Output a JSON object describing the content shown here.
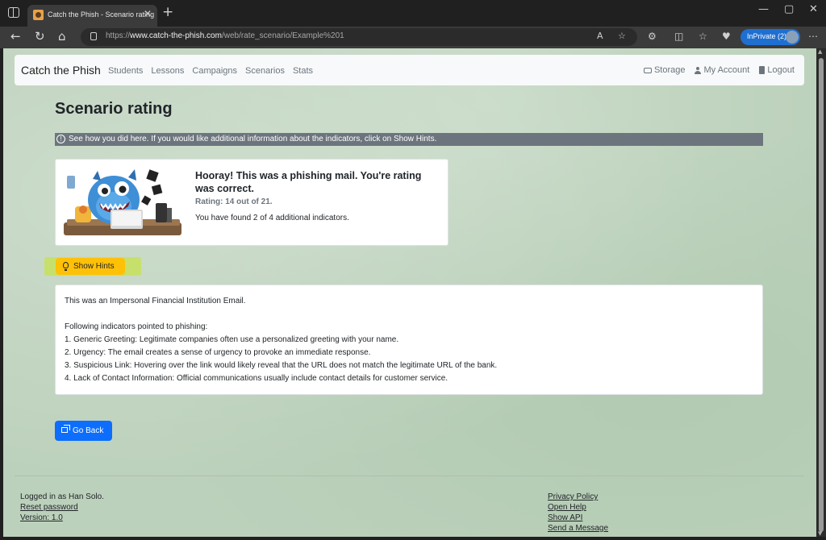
{
  "browser": {
    "tab_title": "Catch the Phish - Scenario rating",
    "url_prefix": "https://",
    "url_domain": "www.catch-the-phish.com",
    "url_path": "/web/rate_scenario/Example%201",
    "inprivate_label": "InPrivate (2)"
  },
  "navbar": {
    "brand": "Catch the Phish",
    "links": [
      "Students",
      "Lessons",
      "Campaigns",
      "Scenarios",
      "Stats"
    ],
    "storage": "Storage",
    "account": "My Account",
    "logout": "Logout"
  },
  "page": {
    "title": "Scenario rating",
    "info": "See how you did here. If you would like additional information about the indicators, click on Show Hints."
  },
  "result": {
    "headline": "Hooray! This was a phishing mail. You're rating was correct.",
    "rating": "Rating: 14 out of 21.",
    "found": "You have found 2 of 4 additional indicators."
  },
  "hints": {
    "button_label": "Show Hints",
    "intro": "This was an Impersonal Financial Institution Email.",
    "lead": "Following indicators pointed to phishing:",
    "items": [
      "1. Generic Greeting: Legitimate companies often use a personalized greeting with your name.",
      "2. Urgency: The email creates a sense of urgency to provoke an immediate response.",
      "3. Suspicious Link: Hovering over the link would likely reveal that the URL does not match the legitimate URL of the bank.",
      "4. Lack of Contact Information: Official communications usually include contact details for customer service."
    ]
  },
  "back_button": "Go Back",
  "footer": {
    "logged_in": "Logged in as Han Solo.",
    "reset": "Reset password",
    "version": "Version: 1.0",
    "links": [
      "Privacy Policy",
      "Open Help",
      "Show API",
      "Send a Message"
    ]
  },
  "colors": {
    "info_bar": "#6c757d",
    "hints_button": "#ffc107",
    "hints_highlight": "#c7e06b",
    "back_button": "#0d6efd",
    "page_background": "#bcd1bb"
  }
}
